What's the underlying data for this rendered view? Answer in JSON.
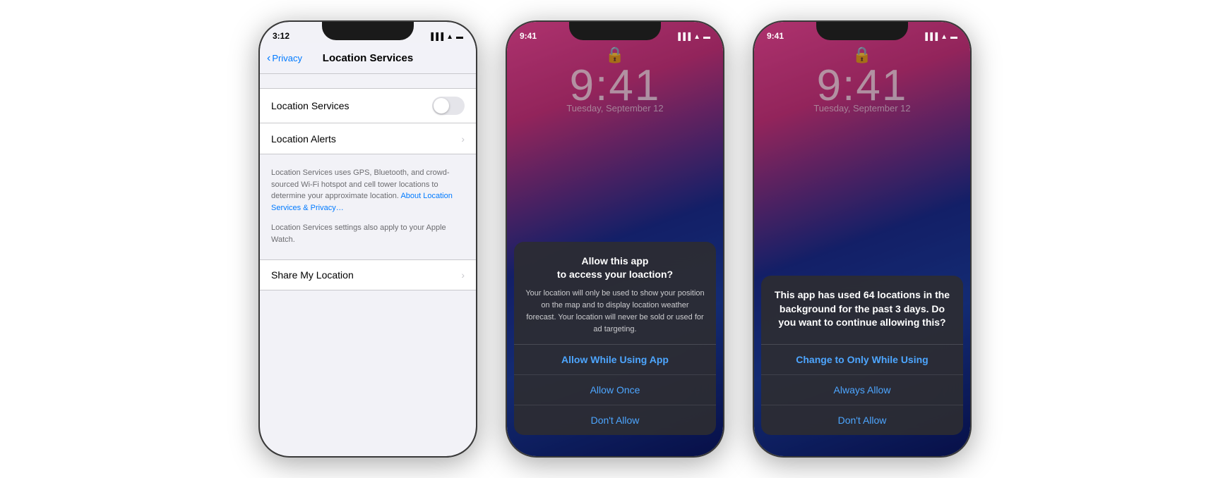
{
  "phones": [
    {
      "id": "settings-phone",
      "statusBar": {
        "time": "3:12",
        "theme": "light",
        "icons": "▐ ▐ ▐ ▌ ▌ ▌ ▲ ▬"
      },
      "navBar": {
        "backLabel": "Privacy",
        "title": "Location Services"
      },
      "cells": [
        {
          "label": "Location Services",
          "type": "toggle"
        },
        {
          "label": "Location Alerts",
          "type": "disclosure"
        }
      ],
      "description": "Location Services uses GPS, Bluetooth, and crowd-sourced Wi-Fi hotspot and cell tower locations to determine your approximate location.",
      "linkText": "About Location Services & Privacy…",
      "description2": "Location Services settings also apply to your Apple Watch.",
      "cells2": [
        {
          "label": "Share My Location",
          "type": "disclosure"
        }
      ]
    },
    {
      "id": "dialog-phone-1",
      "statusBar": {
        "time": "9:41",
        "theme": "dark"
      },
      "lockTime": "9:41",
      "lockDate": "Tuesday, September 12",
      "dialog": {
        "title": "Allow this app\nto access your loaction?",
        "message": "Your location will only be used to show your position on the map and to display location weather forecast. Your location will never be sold or used for ad targeting.",
        "buttons": [
          {
            "label": "Allow While Using App",
            "bold": true
          },
          {
            "label": "Allow Once",
            "bold": false
          },
          {
            "label": "Don't Allow",
            "bold": false
          }
        ]
      }
    },
    {
      "id": "dialog-phone-2",
      "statusBar": {
        "time": "9:41",
        "theme": "dark"
      },
      "lockTime": "9:41",
      "lockDate": "Tuesday, September 12",
      "dialog": {
        "title": "This app has used 64 locations in the background for the past 3 days. Do you want to continue allowing this?",
        "message": "",
        "buttons": [
          {
            "label": "Change to Only While Using",
            "bold": true
          },
          {
            "label": "Always Allow",
            "bold": false
          },
          {
            "label": "Don't Allow",
            "bold": false
          }
        ]
      }
    }
  ]
}
